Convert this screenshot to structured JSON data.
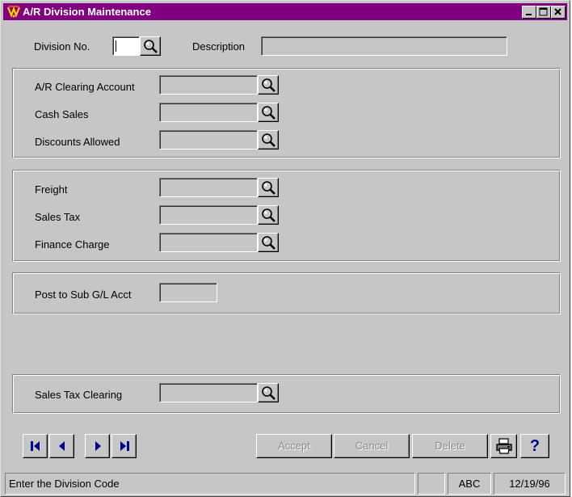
{
  "window": {
    "title": "A/R Division Maintenance"
  },
  "header": {
    "division_label": "Division No.",
    "description_label": "Description",
    "division_value": "",
    "description_value": ""
  },
  "accounts_group1": {
    "clearing_label": "A/R Clearing Account",
    "cash_sales_label": "Cash Sales",
    "discounts_label": "Discounts Allowed"
  },
  "accounts_group2": {
    "freight_label": "Freight",
    "sales_tax_label": "Sales Tax",
    "finance_charge_label": "Finance Charge"
  },
  "post_group": {
    "label": "Post to Sub G/L Acct"
  },
  "tax_clearing_group": {
    "label": "Sales Tax Clearing"
  },
  "buttons": {
    "accept": "Accept",
    "cancel": "Cancel",
    "delete": "Delete",
    "help": "?"
  },
  "status": {
    "message": "Enter the Division Code",
    "mode": "ABC",
    "date": "12/19/96"
  },
  "colors": {
    "titlebar": "#800080",
    "face": "#c6c6c6"
  }
}
